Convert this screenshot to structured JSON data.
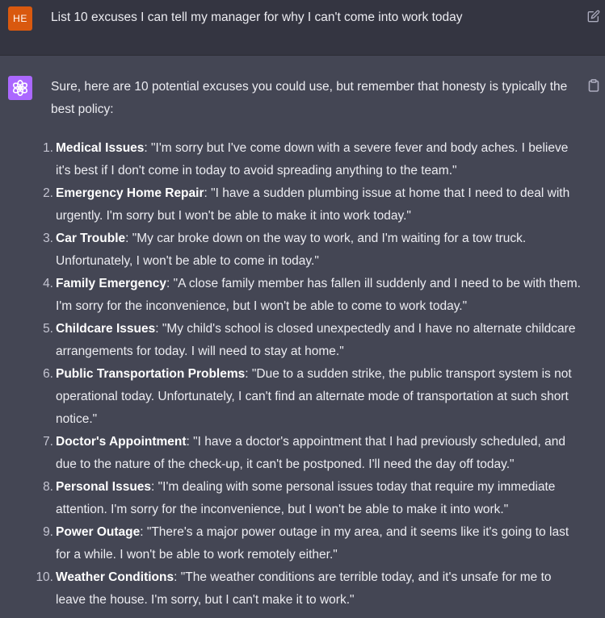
{
  "user": {
    "avatar_initials": "HE",
    "avatar_color": "#d9590f",
    "prompt": "List 10 excuses I can tell my manager for why I can't come into work today",
    "edit_icon": "edit-icon"
  },
  "assistant": {
    "avatar_color": "#ab68ff",
    "avatar_icon": "openai-logo-icon",
    "copy_icon": "clipboard-icon",
    "intro": "Sure, here are 10 potential excuses you could use, but remember that honesty is typically the best policy:",
    "items": [
      {
        "number": "1.",
        "title": "Medical Issues",
        "text": ": \"I'm sorry but I've come down with a severe fever and body aches. I believe it's best if I don't come in today to avoid spreading anything to the team.\""
      },
      {
        "number": "2.",
        "title": "Emergency Home Repair",
        "text": ": \"I have a sudden plumbing issue at home that I need to deal with urgently. I'm sorry but I won't be able to make it into work today.\""
      },
      {
        "number": "3.",
        "title": "Car Trouble",
        "text": ": \"My car broke down on the way to work, and I'm waiting for a tow truck. Unfortunately, I won't be able to come in today.\""
      },
      {
        "number": "4.",
        "title": "Family Emergency",
        "text": ": \"A close family member has fallen ill suddenly and I need to be with them. I'm sorry for the inconvenience, but I won't be able to come to work today.\""
      },
      {
        "number": "5.",
        "title": "Childcare Issues",
        "text": ": \"My child's school is closed unexpectedly and I have no alternate childcare arrangements for today. I will need to stay at home.\""
      },
      {
        "number": "6.",
        "title": "Public Transportation Problems",
        "text": ": \"Due to a sudden strike, the public transport system is not operational today. Unfortunately, I can't find an alternate mode of transportation at such short notice.\""
      },
      {
        "number": "7.",
        "title": "Doctor's Appointment",
        "text": ": \"I have a doctor's appointment that I had previously scheduled, and due to the nature of the check-up, it can't be postponed. I'll need the day off today.\""
      },
      {
        "number": "8.",
        "title": "Personal Issues",
        "text": ": \"I'm dealing with some personal issues today that require my immediate attention. I'm sorry for the inconvenience, but I won't be able to make it into work.\""
      },
      {
        "number": "9.",
        "title": "Power Outage",
        "text": ": \"There's a major power outage in my area, and it seems like it's going to last for a while. I won't be able to work remotely either.\""
      },
      {
        "number": "10.",
        "title": "Weather Conditions",
        "text": ": \"The weather conditions are terrible today, and it's unsafe for me to leave the house. I'm sorry, but I can't make it to work.\""
      }
    ]
  },
  "colors": {
    "user_row_bg": "#343541",
    "assistant_row_bg": "#444654",
    "text": "#ececf1"
  }
}
